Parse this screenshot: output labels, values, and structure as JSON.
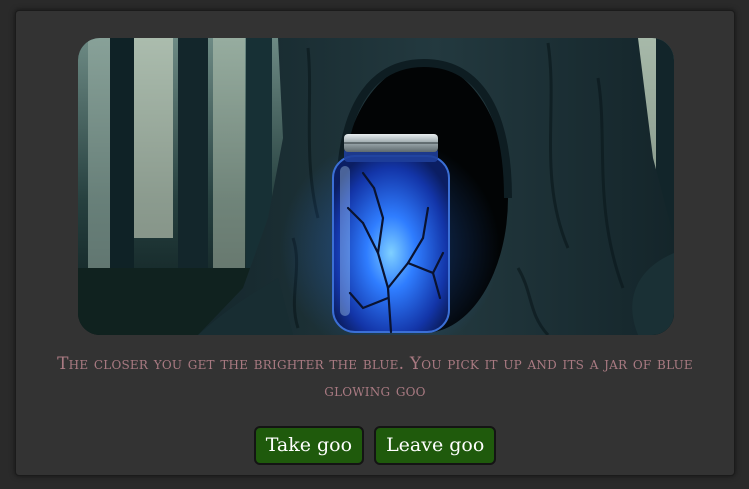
{
  "scene": {
    "image_name": "glowing-jar-in-tree-hollow",
    "accent_glow": "#2e7dff"
  },
  "story": {
    "text": "The closer you get the brighter the blue. You pick it up and its a jar of blue glowing goo"
  },
  "choices": [
    {
      "label": "Take goo"
    },
    {
      "label": "Leave goo"
    }
  ],
  "colors": {
    "panel_background": "#333333",
    "story_text": "#a97a82",
    "button_background": "#1f5a0c",
    "button_text": "#ffffff"
  }
}
